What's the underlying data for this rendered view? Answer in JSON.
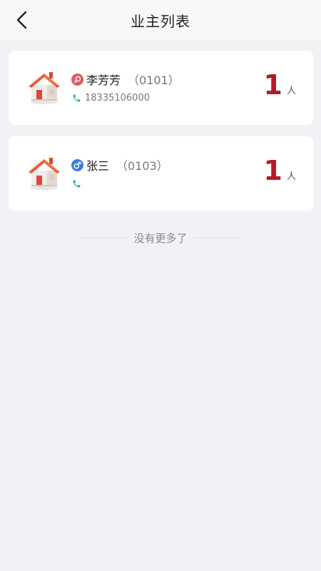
{
  "header": {
    "title": "业主列表"
  },
  "owners": [
    {
      "gender": "female",
      "name": "李芳芳",
      "code": "（0101）",
      "phone": "18335106000",
      "count": "1",
      "unit": "人"
    },
    {
      "gender": "male",
      "name": "张三",
      "code": "（0103）",
      "phone": "",
      "count": "1",
      "unit": "人"
    }
  ],
  "footer": {
    "no_more": "没有更多了"
  },
  "colors": {
    "accent_count": "#b31b2a",
    "female": "#e05a5e",
    "male": "#3e7be0",
    "phone": "#2bb36b"
  },
  "icons": {
    "back": "chevron-left-icon",
    "house": "house-icon",
    "phone": "phone-icon",
    "female": "female-icon",
    "male": "male-icon"
  }
}
